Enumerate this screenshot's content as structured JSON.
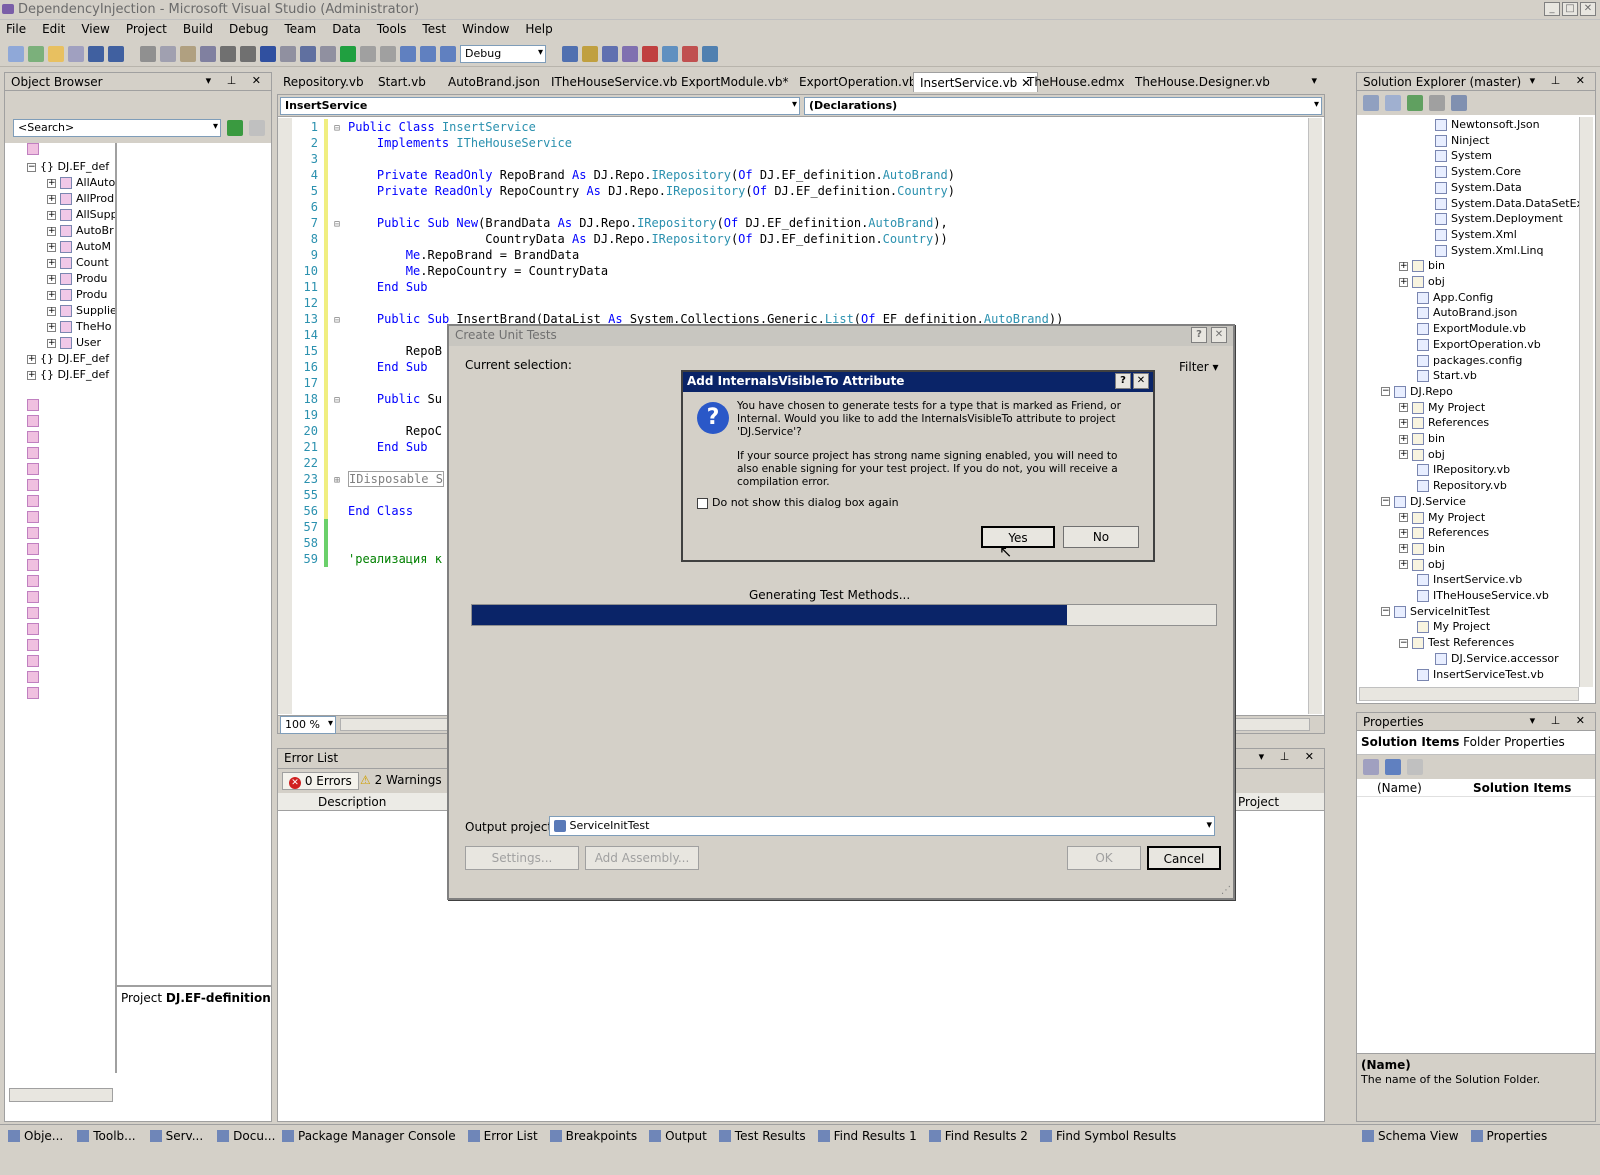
{
  "window": {
    "title": "DependencyInjection - Microsoft Visual Studio (Administrator)"
  },
  "menu": [
    "File",
    "Edit",
    "View",
    "Project",
    "Build",
    "Debug",
    "Team",
    "Data",
    "Tools",
    "Test",
    "Window",
    "Help"
  ],
  "toolbar": {
    "config": "Debug"
  },
  "object_browser": {
    "title": "Object Browser",
    "search_placeholder": "<Search>",
    "tree": [
      {
        "label": "DJ.EF_def",
        "level": 0,
        "expander": "−"
      },
      {
        "label": "AllAuto",
        "level": 1,
        "expander": "+"
      },
      {
        "label": "AllProd",
        "level": 1,
        "expander": "+"
      },
      {
        "label": "AllSupp",
        "level": 1,
        "expander": "+"
      },
      {
        "label": "AutoBr",
        "level": 1,
        "expander": "+"
      },
      {
        "label": "AutoM",
        "level": 1,
        "expander": "+"
      },
      {
        "label": "Count",
        "level": 1,
        "expander": "+"
      },
      {
        "label": "Produ",
        "level": 1,
        "expander": "+"
      },
      {
        "label": "Produ",
        "level": 1,
        "expander": "+"
      },
      {
        "label": "Supplie",
        "level": 1,
        "expander": "+"
      },
      {
        "label": "TheHo",
        "level": 1,
        "expander": "+"
      },
      {
        "label": "User",
        "level": 1,
        "expander": "+"
      },
      {
        "label": "DJ.EF_def",
        "level": 0,
        "expander": "+"
      },
      {
        "label": "DJ.EF_def",
        "level": 0,
        "expander": "+"
      }
    ],
    "project_label": "Project",
    "project_name": "DJ.EF-definition"
  },
  "editor": {
    "tabs": [
      "Repository.vb",
      "Start.vb",
      "AutoBrand.json",
      "ITheHouseService.vb",
      "ExportModule.vb*",
      "ExportOperation.vb",
      "InsertService.vb",
      "TheHouse.edmx",
      "TheHouse.Designer.vb"
    ],
    "active_tab": "InsertService.vb",
    "class_combo": "InsertService",
    "member_combo": "(Declarations)",
    "zoom": "100 %",
    "lines": [
      {
        "n": "1",
        "t": "Public Class InsertService"
      },
      {
        "n": "2",
        "t": "    Implements ITheHouseService"
      },
      {
        "n": "3",
        "t": ""
      },
      {
        "n": "4",
        "t": "    Private ReadOnly RepoBrand As DJ.Repo.IRepository(Of DJ.EF_definition.AutoBrand)"
      },
      {
        "n": "5",
        "t": "    Private ReadOnly RepoCountry As DJ.Repo.IRepository(Of DJ.EF_definition.Country)"
      },
      {
        "n": "6",
        "t": ""
      },
      {
        "n": "7",
        "t": "    Public Sub New(BrandData As DJ.Repo.IRepository(Of DJ.EF_definition.AutoBrand),"
      },
      {
        "n": "8",
        "t": "                   CountryData As DJ.Repo.IRepository(Of DJ.EF_definition.Country))"
      },
      {
        "n": "9",
        "t": "        Me.RepoBrand = BrandData"
      },
      {
        "n": "10",
        "t": "        Me.RepoCountry = CountryData"
      },
      {
        "n": "11",
        "t": "    End Sub"
      },
      {
        "n": "12",
        "t": ""
      },
      {
        "n": "13",
        "t": "    Public Sub InsertBrand(DataList As System.Collections.Generic.List(Of EF_definition.AutoBrand))"
      },
      {
        "n": "14",
        "t": ""
      },
      {
        "n": "15",
        "t": "        RepoB"
      },
      {
        "n": "16",
        "t": "    End Sub"
      },
      {
        "n": "17",
        "t": ""
      },
      {
        "n": "18",
        "t": "    Public Su"
      },
      {
        "n": "19",
        "t": ""
      },
      {
        "n": "20",
        "t": "        RepoC"
      },
      {
        "n": "21",
        "t": "    End Sub"
      },
      {
        "n": "22",
        "t": ""
      },
      {
        "n": "23",
        "t": "IDisposable S"
      },
      {
        "n": "55",
        "t": ""
      },
      {
        "n": "56",
        "t": "End Class"
      },
      {
        "n": "57",
        "t": ""
      },
      {
        "n": "58",
        "t": ""
      },
      {
        "n": "59",
        "t": "'реализация к"
      }
    ]
  },
  "error_list": {
    "title": "Error List",
    "errors": "0 Errors",
    "warnings": "2 Warnings",
    "col_description": "Description",
    "col_project": "Project"
  },
  "solution_explorer": {
    "title": "Solution Explorer (master)",
    "items": [
      {
        "label": "Newtonsoft.Json",
        "indent": 4,
        "exp": ""
      },
      {
        "label": "Ninject",
        "indent": 4,
        "exp": ""
      },
      {
        "label": "System",
        "indent": 4,
        "exp": ""
      },
      {
        "label": "System.Core",
        "indent": 4,
        "exp": ""
      },
      {
        "label": "System.Data",
        "indent": 4,
        "exp": ""
      },
      {
        "label": "System.Data.DataSetExten",
        "indent": 4,
        "exp": ""
      },
      {
        "label": "System.Deployment",
        "indent": 4,
        "exp": ""
      },
      {
        "label": "System.Xml",
        "indent": 4,
        "exp": ""
      },
      {
        "label": "System.Xml.Linq",
        "indent": 4,
        "exp": ""
      },
      {
        "label": "bin",
        "indent": 2,
        "exp": "+"
      },
      {
        "label": "obj",
        "indent": 2,
        "exp": "+"
      },
      {
        "label": "App.Config",
        "indent": 3,
        "exp": ""
      },
      {
        "label": "AutoBrand.json",
        "indent": 3,
        "exp": ""
      },
      {
        "label": "ExportModule.vb",
        "indent": 3,
        "exp": ""
      },
      {
        "label": "ExportOperation.vb",
        "indent": 3,
        "exp": ""
      },
      {
        "label": "packages.config",
        "indent": 3,
        "exp": ""
      },
      {
        "label": "Start.vb",
        "indent": 3,
        "exp": ""
      },
      {
        "label": "DJ.Repo",
        "indent": 1,
        "exp": "−"
      },
      {
        "label": "My Project",
        "indent": 2,
        "exp": "+"
      },
      {
        "label": "References",
        "indent": 2,
        "exp": "+"
      },
      {
        "label": "bin",
        "indent": 2,
        "exp": "+"
      },
      {
        "label": "obj",
        "indent": 2,
        "exp": "+"
      },
      {
        "label": "IRepository.vb",
        "indent": 3,
        "exp": ""
      },
      {
        "label": "Repository.vb",
        "indent": 3,
        "exp": ""
      },
      {
        "label": "DJ.Service",
        "indent": 1,
        "exp": "−"
      },
      {
        "label": "My Project",
        "indent": 2,
        "exp": "+"
      },
      {
        "label": "References",
        "indent": 2,
        "exp": "+"
      },
      {
        "label": "bin",
        "indent": 2,
        "exp": "+"
      },
      {
        "label": "obj",
        "indent": 2,
        "exp": "+"
      },
      {
        "label": "InsertService.vb",
        "indent": 3,
        "exp": ""
      },
      {
        "label": "ITheHouseService.vb",
        "indent": 3,
        "exp": ""
      },
      {
        "label": "ServiceInitTest",
        "indent": 1,
        "exp": "−"
      },
      {
        "label": "My Project",
        "indent": 3,
        "exp": ""
      },
      {
        "label": "Test References",
        "indent": 2,
        "exp": "−"
      },
      {
        "label": "DJ.Service.accessor",
        "indent": 4,
        "exp": ""
      },
      {
        "label": "InsertServiceTest.vb",
        "indent": 3,
        "exp": ""
      }
    ]
  },
  "properties": {
    "title": "Properties",
    "object_bold": "Solution Items",
    "object_rest": "Folder Properties",
    "name_key": "(Name)",
    "name_val": "Solution Items",
    "desc_title": "(Name)",
    "desc_text": "The name of the Solution Folder."
  },
  "create_unit_tests": {
    "title": "Create Unit Tests",
    "current_selection": "Current selection:",
    "filter": "Filter",
    "progress_label": "Generating Test Methods...",
    "progress": 0.8,
    "output_label": "Output project:",
    "output_value": "ServiceInitTest",
    "settings": "Settings...",
    "add_assembly": "Add Assembly...",
    "ok": "OK",
    "cancel": "Cancel"
  },
  "ivt_dialog": {
    "title": "Add InternalsVisibleTo Attribute",
    "msg1": "You have chosen to generate tests for a type that is marked as Friend, or Internal. Would you like to add the InternalsVisibleTo attribute to project 'DJ.Service'?",
    "msg2": "If your source project has strong name signing enabled, you will need to also enable signing for your test project. If you do not, you will receive a compilation error.",
    "checkbox": "Do not show this dialog box again",
    "yes": "Yes",
    "no": "No"
  },
  "bottom_tabs_left": [
    "Obje...",
    "Toolb...",
    "Serv...",
    "Docu..."
  ],
  "bottom_tabs_center": [
    "Package Manager Console",
    "Error List",
    "Breakpoints",
    "Output",
    "Test Results",
    "Find Results 1",
    "Find Results 2",
    "Find Symbol Results"
  ],
  "bottom_tabs_right": [
    "Schema View",
    "Properties"
  ]
}
